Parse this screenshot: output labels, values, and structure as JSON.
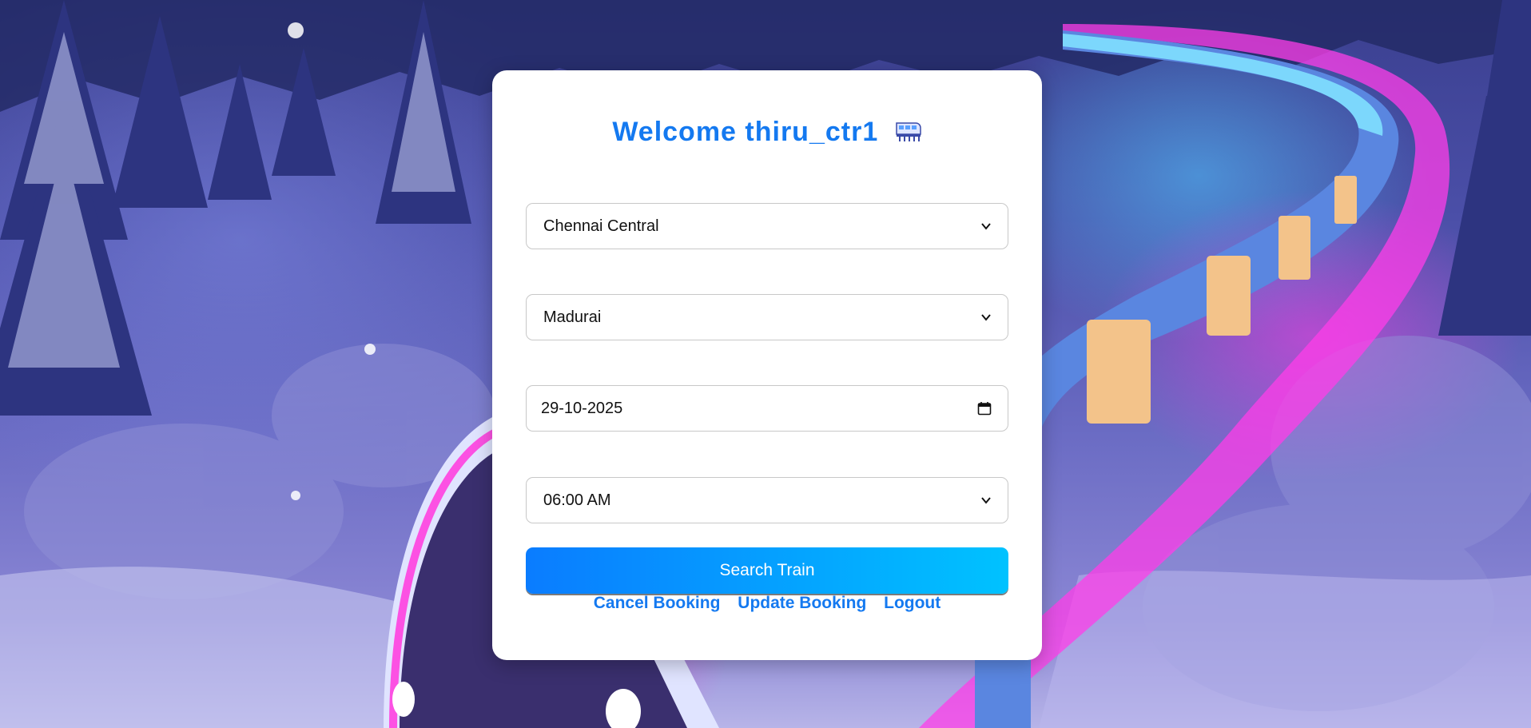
{
  "header": {
    "welcome_text": "Welcome thiru_ctr1",
    "icon": "train-icon"
  },
  "form": {
    "from_station": "Chennai Central",
    "to_station": "Madurai",
    "date": "29-10-2025",
    "time": "06:00 AM"
  },
  "actions": {
    "search_label": "Search Train",
    "cancel_label": "Cancel Booking",
    "update_label": "Update Booking",
    "logout_label": "Logout"
  },
  "colors": {
    "accent": "#1479f0",
    "button_start": "#0a7cff",
    "button_end": "#00c2ff"
  }
}
